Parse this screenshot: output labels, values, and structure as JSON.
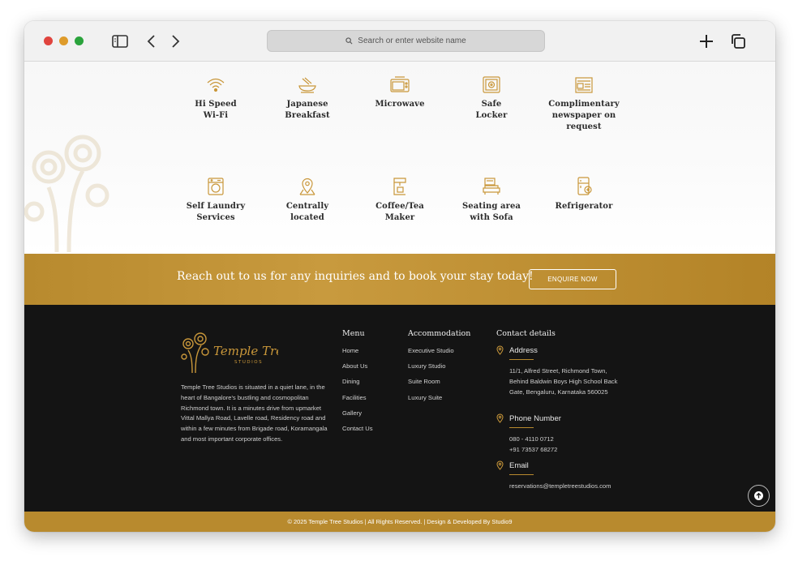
{
  "browser": {
    "address_placeholder": "Search or enter website name",
    "icons": [
      "sidebar-icon",
      "back-icon",
      "forward-icon",
      "new-tab-icon",
      "tabs-icon",
      "search-icon"
    ]
  },
  "amenities": [
    {
      "line1": "Hi Speed",
      "line2": "Wi-Fi",
      "line3": "",
      "icon": "wifi-icon"
    },
    {
      "line1": "Japanese",
      "line2": "Breakfast",
      "line3": "",
      "icon": "breakfast-icon"
    },
    {
      "line1": "Microwave",
      "line2": "",
      "line3": "",
      "icon": "microwave-icon"
    },
    {
      "line1": "Safe",
      "line2": "Locker",
      "line3": "",
      "icon": "safe-icon"
    },
    {
      "line1": "Complimentary",
      "line2": "newspaper on",
      "line3": "request",
      "icon": "newspaper-icon"
    },
    {
      "line1": "Self Laundry",
      "line2": "Services",
      "line3": "",
      "icon": "laundry-icon"
    },
    {
      "line1": "Centrally",
      "line2": "located",
      "line3": "",
      "icon": "location-icon"
    },
    {
      "line1": "Coffee/Tea",
      "line2": "Maker",
      "line3": "",
      "icon": "coffee-maker-icon"
    },
    {
      "line1": "Seating area",
      "line2": "with Sofa",
      "line3": "",
      "icon": "sofa-icon"
    },
    {
      "line1": "Refrigerator",
      "line2": "",
      "line3": "",
      "icon": "refrigerator-icon"
    }
  ],
  "cta": {
    "text": "Reach out to us for any inquiries and to book your stay today!",
    "button": "ENQUIRE NOW"
  },
  "footer": {
    "logo_text": "Temple Tree",
    "logo_sub": "STUDIOS",
    "about": "Temple Tree Studios is situated in a quiet lane, in the heart of Bangalore's bustling and cosmopolitan Richmond town. It is a minutes drive from upmarket Vittal Mallya Road, Lavelle road, Residency road and within a few minutes from Brigade road, Koramangala and most important corporate offices.",
    "menu_title": "Menu",
    "menu": [
      "Home",
      "About Us",
      "Dining",
      "Facilities",
      "Gallery",
      "Contact Us"
    ],
    "accommodation_title": "Accommodation",
    "accommodation": [
      "Executive Studio",
      "Luxury Studio",
      "Suite Room",
      "Luxury Suite"
    ],
    "contact_title": "Contact details",
    "address_label": "Address",
    "address": "11/1, Alfred Street, Richmond Town, Behind Baldwin Boys High School Back Gate, Bengaluru, Karnataka 560025",
    "phone_label": "Phone Number",
    "phone1": "080 - 4110 0712",
    "phone2": "+91 73537 68272",
    "email_label": "Email",
    "email": "reservations@templetreestudios.com",
    "copyright": "© 2025 Temple Tree Studios | All Rights Reserved. |  Design & Developed By Studio9"
  },
  "colors": {
    "gold": "#b88a2e",
    "footer_bg": "#141414",
    "chrome_bg": "#f1f1f1"
  }
}
